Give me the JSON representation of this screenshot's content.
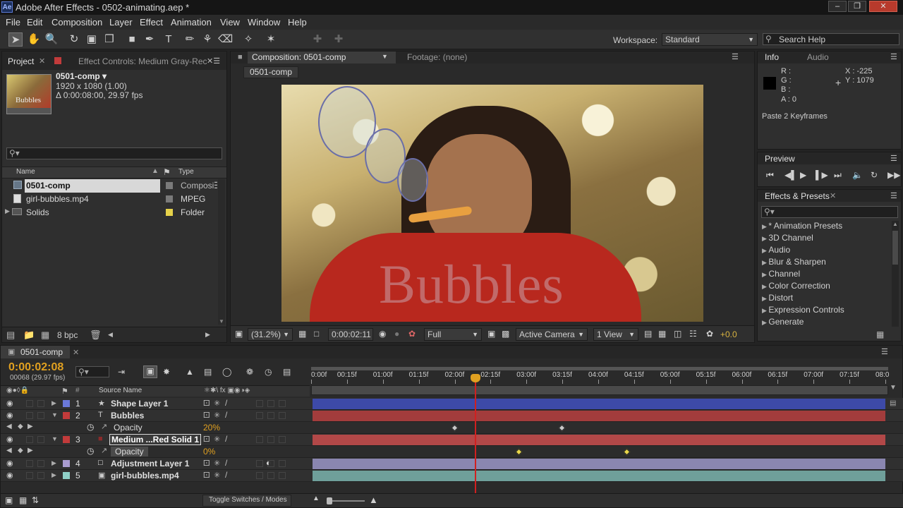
{
  "window": {
    "title": "Adobe After Effects - 0502-animating.aep *",
    "logo": "Ae"
  },
  "menu": [
    "File",
    "Edit",
    "Composition",
    "Layer",
    "Effect",
    "Animation",
    "View",
    "Window",
    "Help"
  ],
  "toolbar": {
    "workspace_label": "Workspace:",
    "workspace_value": "Standard",
    "search_placeholder": "Search Help"
  },
  "project_panel": {
    "tabs": [
      "Project",
      "Effect Controls: Medium Gray-Rec"
    ],
    "comp_name": "0501-comp ▾",
    "comp_size": "1920 x 1080 (1.00)",
    "comp_duration": "Δ 0:00:08:00, 29.97 fps",
    "thumb_text": "Bubbles",
    "columns": {
      "name": "Name",
      "type": "Type"
    },
    "items": [
      {
        "name": "0501-comp",
        "type": "Composi",
        "color": "#7a7a7a",
        "icon": "composition-icon"
      },
      {
        "name": "girl-bubbles.mp4",
        "type": "MPEG",
        "color": "#7a7a7a",
        "icon": "footage-icon"
      },
      {
        "name": "Solids",
        "type": "Folder",
        "color": "#e6d24a",
        "icon": "folder-icon"
      }
    ],
    "bpc": "8 bpc"
  },
  "comp_panel": {
    "tabs": [
      "Composition: 0501-comp",
      "Footage: (none)"
    ],
    "breadcrumb": "0501-comp",
    "overlay_text": "Bubbles",
    "zoom": "(31.2%)",
    "timecode": "0:00:02:11",
    "resolution": "Full",
    "camera": "Active Camera",
    "view": "1 View",
    "exposure": "+0.0"
  },
  "info_panel": {
    "tabs": [
      "Info",
      "Audio"
    ],
    "r": "R :",
    "g": "G :",
    "b": "B :",
    "a": "A : 0",
    "x": "X : -225",
    "y": "Y : 1079",
    "message": "Paste 2 Keyframes"
  },
  "preview_panel": {
    "tab": "Preview"
  },
  "effects_panel": {
    "tab": "Effects & Presets",
    "items": [
      "* Animation Presets",
      "3D Channel",
      "Audio",
      "Blur & Sharpen",
      "Channel",
      "Color Correction",
      "Distort",
      "Expression Controls",
      "Generate"
    ]
  },
  "timeline": {
    "tab": "0501-comp",
    "timecode": "0:00:02:08",
    "frame_info": "00068 (29.97 fps)",
    "source_name_header": "Source Name",
    "ruler": [
      "0:00f",
      "00:15f",
      "01:00f",
      "01:15f",
      "02:00f",
      "02:15f",
      "03:00f",
      "03:15f",
      "04:00f",
      "04:15f",
      "05:00f",
      "05:15f",
      "06:00f",
      "06:15f",
      "07:00f",
      "07:15f",
      "08:0"
    ],
    "playhead_seconds": 2.28,
    "duration_seconds": 8,
    "layers": [
      {
        "num": "1",
        "name": "Shape Layer 1",
        "label_color": "#6a78d8",
        "bar_color": "#3d4aa8",
        "icon": "star-icon"
      },
      {
        "num": "2",
        "name": "Bubbles",
        "label_color": "#c23b3b",
        "bar_color": "#a23c3c",
        "icon": "text-icon"
      },
      {
        "num": "3",
        "name": "Medium ...Red Solid 1",
        "label_color": "#c23b3b",
        "bar_color": "#b24848",
        "icon": "solid-icon"
      },
      {
        "num": "4",
        "name": "Adjustment Layer 1",
        "label_color": "#a99cd0",
        "bar_color": "#8a86b0",
        "icon": "adjustment-icon"
      },
      {
        "num": "5",
        "name": "girl-bubbles.mp4",
        "label_color": "#8fd0c8",
        "bar_color": "#6f9f9a",
        "icon": "footage-icon"
      }
    ],
    "opacity_rows": [
      {
        "label": "Opacity",
        "value": "20%",
        "keyframes_seconds": [
          2.0,
          3.5
        ],
        "kf_color": "#c8c8c8"
      },
      {
        "label": "Opacity",
        "value": "0%",
        "keyframes_seconds": [
          2.9,
          4.4
        ],
        "kf_color": "#e8d64a"
      }
    ],
    "toggle_label": "Toggle Switches / Modes"
  }
}
